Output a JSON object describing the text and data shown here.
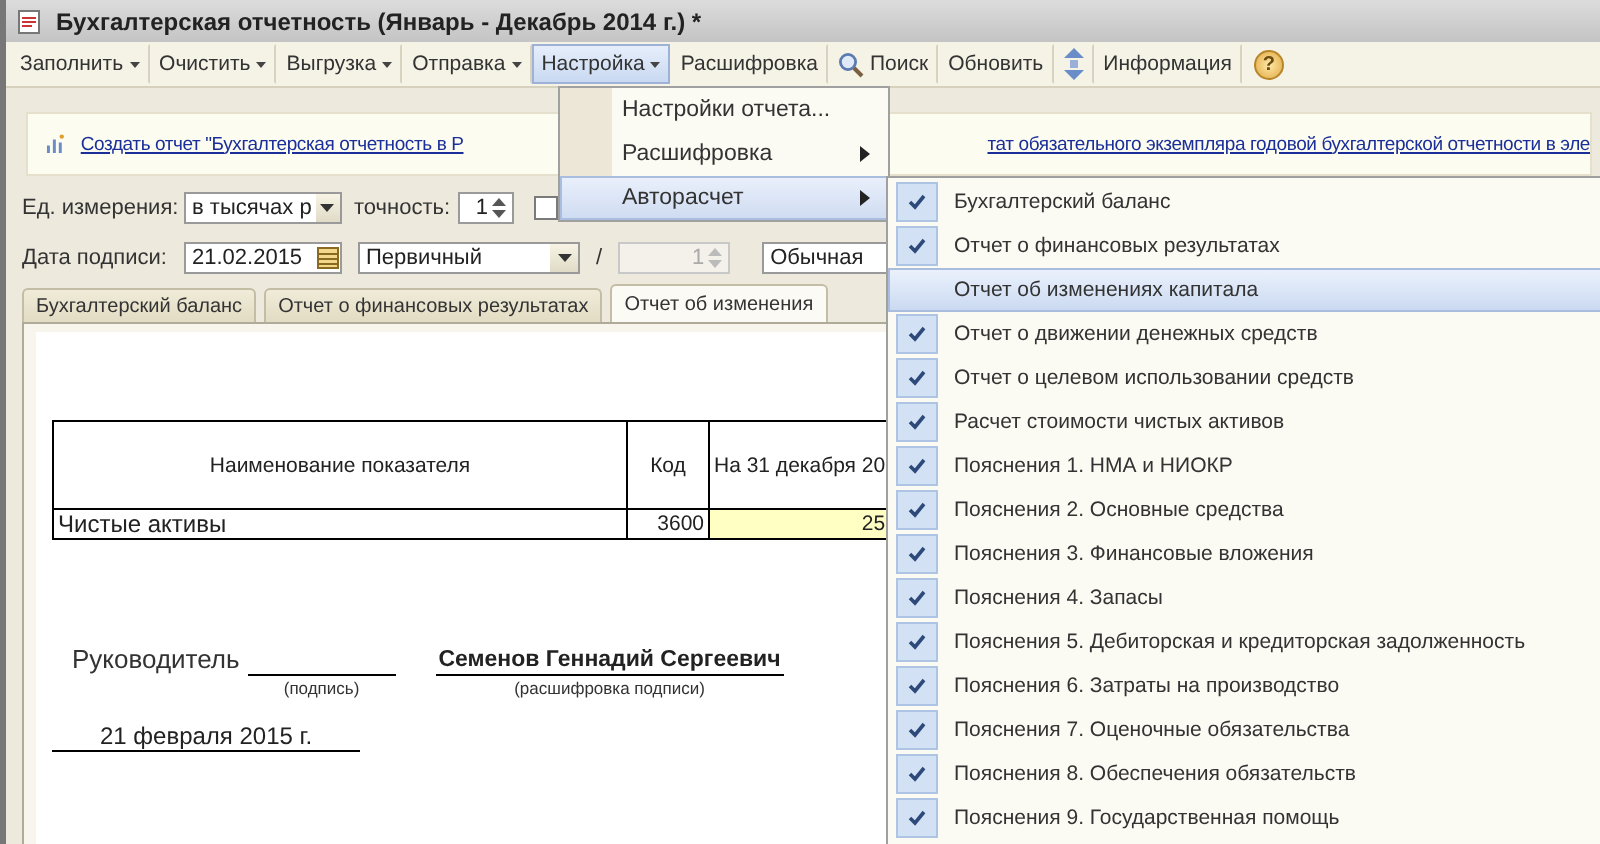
{
  "window": {
    "title": "Бухгалтерская отчетность (Январь - Декабрь 2014 г.) *"
  },
  "toolbar": [
    {
      "label": "Заполнить",
      "kind": "dropdown",
      "selected": false
    },
    {
      "label": "Очистить",
      "kind": "dropdown",
      "selected": false
    },
    {
      "label": "Выгрузка",
      "kind": "dropdown",
      "selected": false
    },
    {
      "label": "Отправка",
      "kind": "dropdown",
      "selected": false
    },
    {
      "label": "Настройка",
      "kind": "dropdown",
      "selected": true
    },
    {
      "label": "Расшифровка",
      "kind": "button",
      "selected": false
    },
    {
      "label": "Поиск",
      "kind": "search",
      "selected": false
    },
    {
      "label": "Обновить",
      "kind": "button",
      "selected": false
    },
    {
      "kind": "icon",
      "selected": false
    },
    {
      "label": "Информация",
      "kind": "button",
      "selected": false
    },
    {
      "label": "?",
      "kind": "help",
      "selected": false
    }
  ],
  "banner": {
    "link_start": "Создать отчет \"Бухгалтерская отчетность в Р",
    "link_end": "тат обязательного экземпляра годовой бухгалтерской отчетности в эле"
  },
  "units": {
    "label": "Ед. измерения:",
    "value": "в тысячах р",
    "precision_label": "точность:",
    "precision": "1",
    "checked": false
  },
  "signing": {
    "label": "Дата подписи:",
    "date": "21.02.2015",
    "type": "Первичный",
    "separator": "/",
    "number": "1",
    "number_disabled": true,
    "mode": "Обычная"
  },
  "tabs": [
    {
      "label": "Бухгалтерский баланс",
      "selected": false
    },
    {
      "label": "Отчет о финансовых результатах",
      "selected": false
    },
    {
      "label": "Отчет об изменения",
      "selected": true
    }
  ],
  "table": {
    "columns": [
      "Наименование показателя",
      "Код",
      "На 31 декабря 20"
    ],
    "rows": [
      {
        "cells": [
          "Чистые активы",
          "3600",
          "25"
        ]
      }
    ]
  },
  "signatures": {
    "role": "Руководитель",
    "signature_caption": "(подпись)",
    "name": "Семенов Геннадий Сергеевич",
    "name_caption": "(расшифровка подписи)",
    "date": "21 февраля 2015 г."
  },
  "menu": {
    "items": [
      {
        "label": "Настройки отчета...",
        "submenu": false,
        "selected": false
      },
      {
        "label": "Расшифровка",
        "submenu": true,
        "selected": false
      },
      {
        "label": "Авторасчет",
        "submenu": true,
        "selected": true
      }
    ]
  },
  "submenu": {
    "items": [
      {
        "label": "Бухгалтерский баланс",
        "checked": true,
        "selected": false
      },
      {
        "label": "Отчет о финансовых результатах",
        "checked": true,
        "selected": false
      },
      {
        "label": "Отчет об изменениях капитала",
        "checked": false,
        "selected": true
      },
      {
        "label": "Отчет о движении денежных средств",
        "checked": true,
        "selected": false
      },
      {
        "label": "Отчет о целевом использовании средств",
        "checked": true,
        "selected": false
      },
      {
        "label": "Расчет стоимости чистых активов",
        "checked": true,
        "selected": false
      },
      {
        "label": "Пояснения 1. НМА и НИОКР",
        "checked": true,
        "selected": false
      },
      {
        "label": "Пояснения 2. Основные средства",
        "checked": true,
        "selected": false
      },
      {
        "label": "Пояснения 3. Финансовые вложения",
        "checked": true,
        "selected": false
      },
      {
        "label": "Пояснения 4. Запасы",
        "checked": true,
        "selected": false
      },
      {
        "label": "Пояснения 5. Дебиторская и кредиторская задолженность",
        "checked": true,
        "selected": false
      },
      {
        "label": "Пояснения 6. Затраты на производство",
        "checked": true,
        "selected": false
      },
      {
        "label": "Пояснения 7. Оценочные обязательства",
        "checked": true,
        "selected": false
      },
      {
        "label": "Пояснения 8. Обеспечения обязательств",
        "checked": true,
        "selected": false
      },
      {
        "label": "Пояснения 9. Государственная помощь",
        "checked": true,
        "selected": false
      }
    ]
  }
}
